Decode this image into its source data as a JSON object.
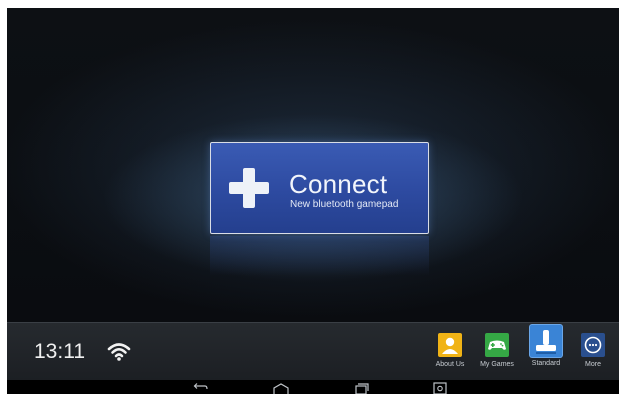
{
  "connect": {
    "title": "Connect",
    "subtitle": "New bluetooth gamepad",
    "icon": "plus-icon"
  },
  "status": {
    "time": "13:11",
    "wifi_icon": "wifi-icon"
  },
  "dock": {
    "items": [
      {
        "label": "About Us",
        "icon": "about-us-icon",
        "color": "#f0b316",
        "active": false
      },
      {
        "label": "My Games",
        "icon": "gamepad-icon",
        "color": "#35a845",
        "active": false
      },
      {
        "label": "Standard",
        "icon": "joystick-icon",
        "color": "#3a84d6",
        "active": true
      },
      {
        "label": "More",
        "icon": "more-icon",
        "color": "#2a4f8e",
        "active": false
      }
    ]
  },
  "nav": {
    "back_icon": "back-icon",
    "home_icon": "home-icon",
    "recents_icon": "recents-icon",
    "screenshot_icon": "screenshot-icon"
  },
  "colors": {
    "connect_button": "#2d4aa0",
    "background": "#0b0e12"
  }
}
